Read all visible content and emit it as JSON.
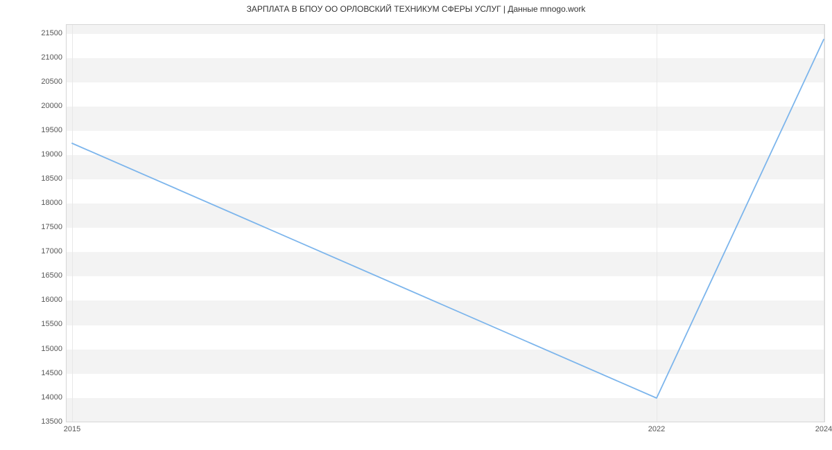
{
  "chart_data": {
    "type": "line",
    "title": "ЗАРПЛАТА В БПОУ ОО ОРЛОВСКИЙ ТЕХНИКУМ СФЕРЫ УСЛУГ | Данные mnogo.work",
    "xlabel": "",
    "ylabel": "",
    "x": [
      2015,
      2022,
      2024
    ],
    "values": [
      19250,
      13980,
      21400
    ],
    "x_ticks": [
      2015,
      2022,
      2024
    ],
    "y_ticks": [
      13500,
      14000,
      14500,
      15000,
      15500,
      16000,
      16500,
      17000,
      17500,
      18000,
      18500,
      19000,
      19500,
      20000,
      20500,
      21000,
      21500
    ],
    "xlim": [
      2015,
      2024
    ],
    "ylim": [
      13500,
      21700
    ],
    "grid": true,
    "accent": "#7cb5ec"
  }
}
